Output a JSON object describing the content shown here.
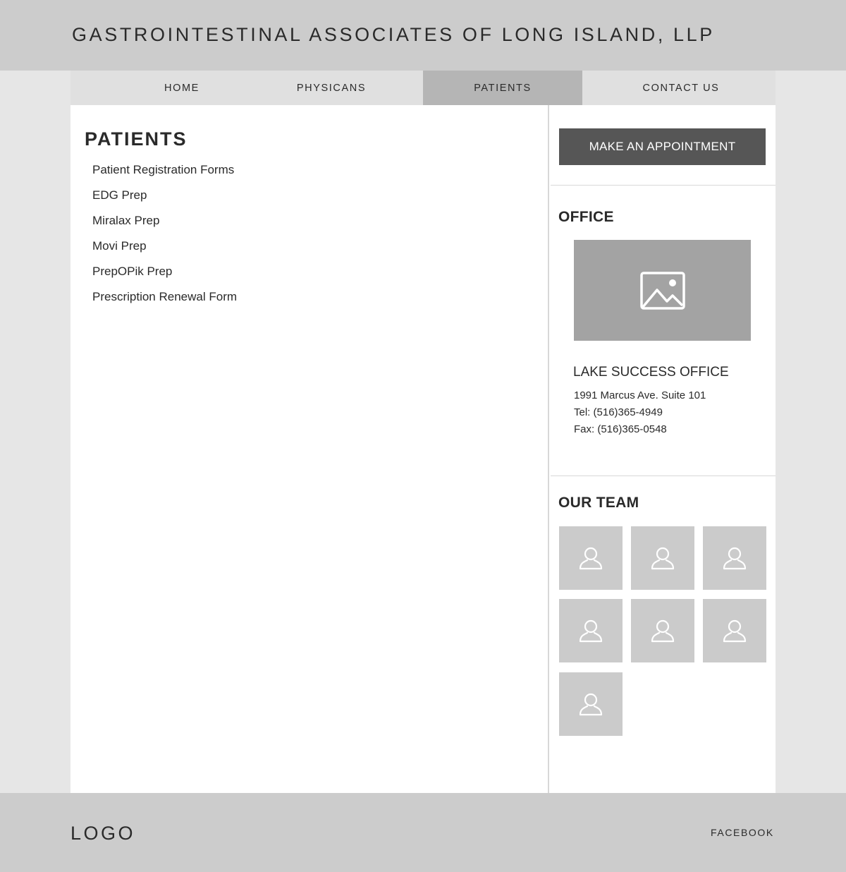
{
  "header": {
    "title": "GASTROINTESTINAL ASSOCIATES OF LONG ISLAND, LLP"
  },
  "nav": {
    "items": [
      {
        "label": "HOME",
        "active": false
      },
      {
        "label": "PHYSICANS",
        "active": false
      },
      {
        "label": "PATIENTS",
        "active": true
      },
      {
        "label": "CONTACT US",
        "active": false
      }
    ]
  },
  "main": {
    "title": "PATIENTS",
    "links": [
      "Patient Registration Forms",
      "EDG Prep",
      "Miralax Prep",
      "Movi Prep",
      "PrepOPik Prep",
      "Prescription Renewal Form"
    ]
  },
  "sidebar": {
    "appointment_button": "MAKE AN APPOINTMENT",
    "office": {
      "heading": "OFFICE",
      "image_icon": "image-placeholder-icon",
      "name": "LAKE SUCCESS OFFICE",
      "address": "1991 Marcus Ave. Suite 101",
      "tel": "Tel: (516)365-4949",
      "fax": "Fax: (516)365-0548"
    },
    "team": {
      "heading": "OUR TEAM",
      "member_icon": "person-icon",
      "member_count": 7
    }
  },
  "footer": {
    "logo": "LOGO",
    "facebook": "FACEBOOK"
  },
  "colors": {
    "header_bg": "#cccccc",
    "page_bg": "#e6e6e6",
    "nav_bg": "#e0e0e0",
    "nav_active_bg": "#b5b5b5",
    "button_bg": "#565656",
    "placeholder_bg": "#a3a3a3",
    "tile_bg": "#cbcbcb"
  }
}
